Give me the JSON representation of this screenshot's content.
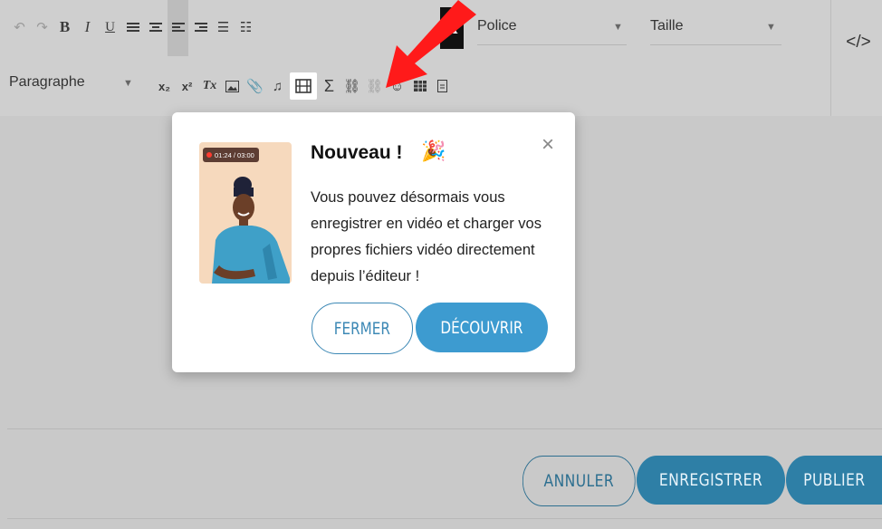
{
  "toolbar": {
    "font_dropdown": "Police",
    "size_dropdown": "Taille",
    "paragraph_dropdown": "Paragraphe",
    "bold": "B",
    "italic": "I",
    "underline": "U",
    "sub": "x₂",
    "sup": "x²",
    "clear": "Tx",
    "sigma": "Σ",
    "block_letter": "A",
    "code": "</>"
  },
  "popup": {
    "title": "Nouveau !",
    "timer": "01:24 / 03:00",
    "body": "Vous pouvez désormais vous enregistrer en vidéo et charger vos propres fichiers vidéo directement depuis l’éditeur !",
    "close_label": "FERMER",
    "discover_label": "DÉCOUVRIR"
  },
  "footer": {
    "cancel": "ANNULER",
    "save": "ENREGISTRER",
    "publish": "PUBLIER"
  },
  "colors": {
    "accent": "#2e7fa6",
    "popup_button": "#3d9bd0",
    "arrow": "#ff1a1a"
  }
}
